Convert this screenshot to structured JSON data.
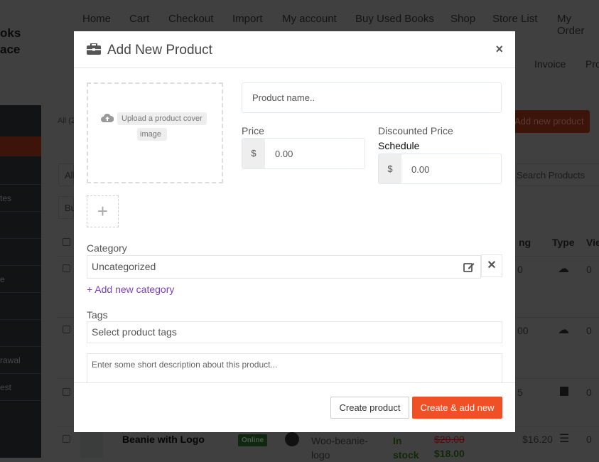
{
  "background": {
    "logo_fragments": [
      "oks",
      "ace"
    ],
    "top_nav": [
      "Home",
      "Cart",
      "Checkout",
      "Import",
      "My account",
      "Buy Used Books",
      "Shop",
      "Store List",
      "My Order"
    ],
    "sub_nav": [
      "Invoice",
      "Pro"
    ],
    "sidebar_fragments": [
      "tes",
      "e",
      "rawal",
      "est"
    ],
    "status_filter": "All (2",
    "add_new_product": "Add new product",
    "filter_all": "All",
    "bulk": "Bu",
    "search_placeholder": "Search Products",
    "table_headers": {
      "listing": "ng",
      "type": "Type",
      "views": "Vie"
    },
    "rows": [
      {
        "price": "0",
        "type_icon": "cloud-icon",
        "views": "0"
      },
      {
        "price": "00",
        "type_icon": "cloud-icon",
        "views": "0"
      },
      {
        "price": "5",
        "type_icon": "calendar-icon",
        "views": "0"
      },
      {
        "name": "Beanie with Logo",
        "status": "Online",
        "sku": "Woo-beanie-logo",
        "stock": "In stock",
        "old_price": "$20.00",
        "new_price": "$18.00",
        "earning": "$16.20",
        "type_icon": "bars-icon",
        "views": "0"
      }
    ]
  },
  "modal": {
    "title": "Add New Product",
    "title_icon": "briefcase-icon",
    "close": "×",
    "upload_text_1": "Upload a product cover",
    "upload_text_2": "image",
    "product_name_placeholder": "Product name..",
    "price_label": "Price",
    "currency": "$",
    "price_placeholder": "0.00",
    "discount_label": "Discounted Price",
    "schedule_label": "Schedule",
    "discount_placeholder": "0.00",
    "category_label": "Category",
    "category_value": "Uncategorized",
    "add_category": "+ Add new category",
    "tags_label": "Tags",
    "tags_placeholder": "Select product tags",
    "description_placeholder": "Enter some short description about this product...",
    "create_button": "Create product",
    "create_add_button": "Create & add new",
    "accent": "#f05025",
    "link_color": "#7a3fbf"
  }
}
